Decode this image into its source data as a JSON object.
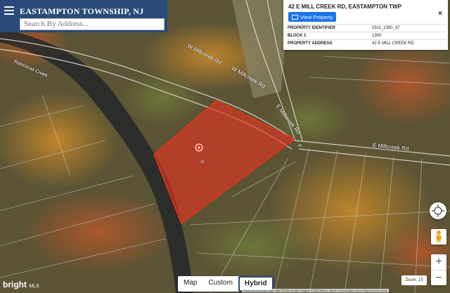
{
  "header": {
    "township": "EASTAMPTON TOWNSHIP, NJ",
    "search_placeholder": "Search By Address..."
  },
  "property_card": {
    "title": "42 E MILL CREEK RD, EASTAMPTON TWP",
    "view_button": "View Property",
    "close": "×",
    "rows": [
      {
        "key": "PROPERTY IDENTIFIER",
        "value": "0311_1300_37"
      },
      {
        "key": "BLOCK 1",
        "value": "1300"
      },
      {
        "key": "PROPERTY ADDRESS",
        "value": "42 E MILL CREEK RD"
      }
    ]
  },
  "map": {
    "roads": {
      "w_millcreek_1": "W Millcreek Rd",
      "w_millcreek_2": "W Millcreek Rd",
      "e_millcreek_1": "E Millcreek Rd",
      "e_millcreek_2": "E Millcreek Rd",
      "creek": "Rancocas Creek"
    },
    "lot_numbers": {
      "lot_a": "42",
      "lot_b": "40"
    },
    "highlight_color": "#e8321e"
  },
  "map_type": {
    "options": [
      "Map",
      "Custom",
      "Hybrid"
    ],
    "selected": "Hybrid"
  },
  "zoom": {
    "label": "Zoom: 15",
    "in": "+",
    "out": "−"
  },
  "branding": {
    "name": "bright",
    "suffix": "MLS"
  },
  "attribution": "Keyboard shortcuts   Map data ©2026 Google Imagery ©2026 Airbus, Maxar Technologies   Terms   Report a map error"
}
